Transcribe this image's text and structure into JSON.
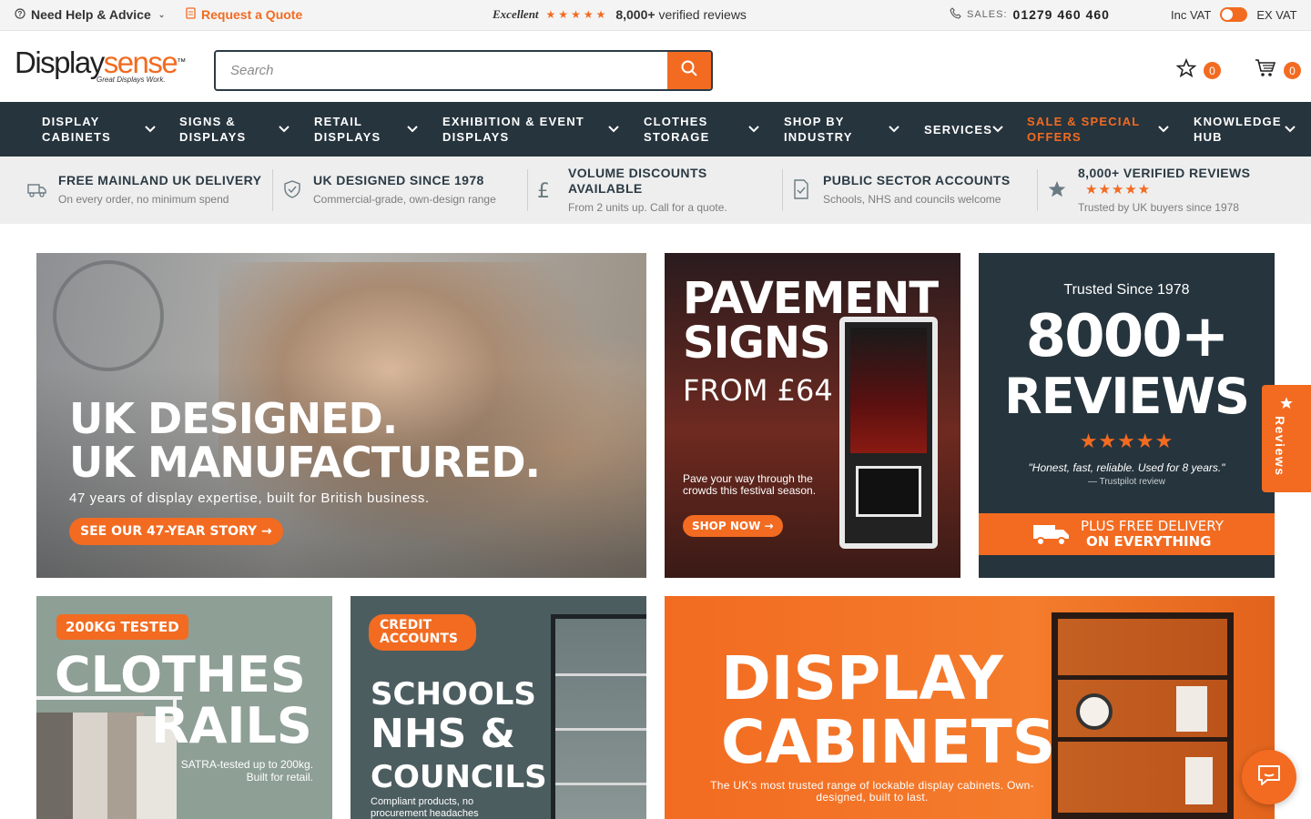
{
  "topbar": {
    "help_label": "Need Help & Advice",
    "quote_label": "Request a Quote",
    "rating_word": "Excellent",
    "rating_stars": "★★★★★",
    "reviews_count": "8,000+",
    "reviews_suffix": "verified reviews",
    "sales_label": "SALES:",
    "sales_number": "01279 460 460",
    "inc_vat": "Inc VAT",
    "ex_vat": "EX VAT"
  },
  "header": {
    "logo_display": "Display",
    "logo_sense": "sense",
    "logo_tm": "™",
    "logo_tagline": "Great Displays Work.",
    "search_placeholder": "Search",
    "wishlist_count": "0",
    "cart_count": "0"
  },
  "nav": {
    "items": [
      {
        "line1": "Display",
        "line2": "Cabinets"
      },
      {
        "line1": "Signs &",
        "line2": "Displays"
      },
      {
        "line1": "Retail",
        "line2": "Displays"
      },
      {
        "line1": "Exhibition & Event",
        "line2": "Displays"
      },
      {
        "line1": "Clothes",
        "line2": "Storage"
      },
      {
        "line1": "Shop by",
        "line2": "Industry"
      },
      {
        "line1": "Services",
        "line2": ""
      },
      {
        "line1": "Sale & Special",
        "line2": "Offers"
      },
      {
        "line1": "Knowledge",
        "line2": "Hub"
      }
    ]
  },
  "usp": {
    "items": [
      {
        "title": "Free mainland UK delivery",
        "sub": "On every order, no minimum spend"
      },
      {
        "title": "UK designed since 1978",
        "sub": "Commercial-grade, own-design range"
      },
      {
        "title": "Volume discounts available",
        "sub": "From 2 units up. Call for a quote."
      },
      {
        "title": "Public sector accounts",
        "sub": "Schools, NHS and councils welcome"
      },
      {
        "title": "8,000+ verified reviews",
        "stars": "★★★★★",
        "sub": "Trusted by UK buyers since 1978"
      }
    ]
  },
  "banners": {
    "hero": {
      "line1": "UK DESIGNED.",
      "line2": "UK MANUFACTURED.",
      "sub": "47 years of display expertise, built for British business.",
      "cta": "SEE OUR 47-YEAR STORY →"
    },
    "pavement": {
      "line1": "PAVEMENT",
      "line2": "SIGNS",
      "price": "FROM £64",
      "sub": "Pave your way through the crowds this festival season.",
      "cta": "SHOP NOW →"
    },
    "reviews": {
      "trusted": "Trusted Since 1978",
      "big": "8000+",
      "word": "REVIEWS",
      "stars": "★★★★★",
      "quote": "\"Honest, fast, reliable. Used for 8 years.\"",
      "source": "— Trustpilot review",
      "delivery_line1": "PLUS FREE DELIVERY",
      "delivery_line2": "ON EVERYTHING"
    },
    "rails": {
      "badge": "200KG TESTED",
      "line1": "CLOTHES",
      "line2": "RAILS",
      "sub": "SATRA-tested up to 200kg. Built for retail."
    },
    "schools": {
      "badge": "CREDIT ACCOUNTS",
      "line1": "SCHOOLS",
      "line2": "NHS &",
      "line3": "COUNCILS",
      "sub": "Compliant products, no procurement headaches"
    },
    "cabinets": {
      "line1": "DISPLAY",
      "line2": "CABINETS",
      "sub": "The UK's most trusted range of lockable display cabinets. Own-designed, built to last."
    }
  },
  "floating": {
    "reviews_tab": "Reviews"
  },
  "colors": {
    "brand_orange": "#f26b21",
    "nav_dark": "#26343d"
  }
}
